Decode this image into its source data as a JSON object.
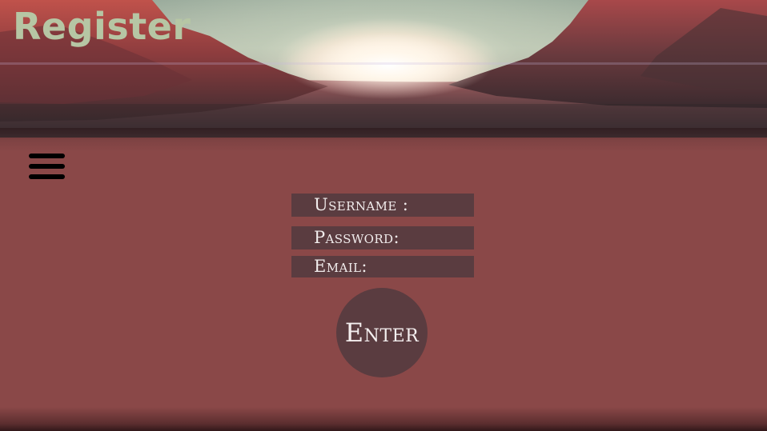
{
  "header": {
    "title": "Register"
  },
  "menu": {
    "icon": "hamburger-menu-icon"
  },
  "form": {
    "username_label": "Username :",
    "password_label": "Password:",
    "email_label": "Email:",
    "submit_label": "Enter"
  },
  "colors": {
    "background": "#8a4848",
    "field_background": "#5a3c40",
    "title_color": "#b6c6a4",
    "label_color": "#f1ecec"
  }
}
